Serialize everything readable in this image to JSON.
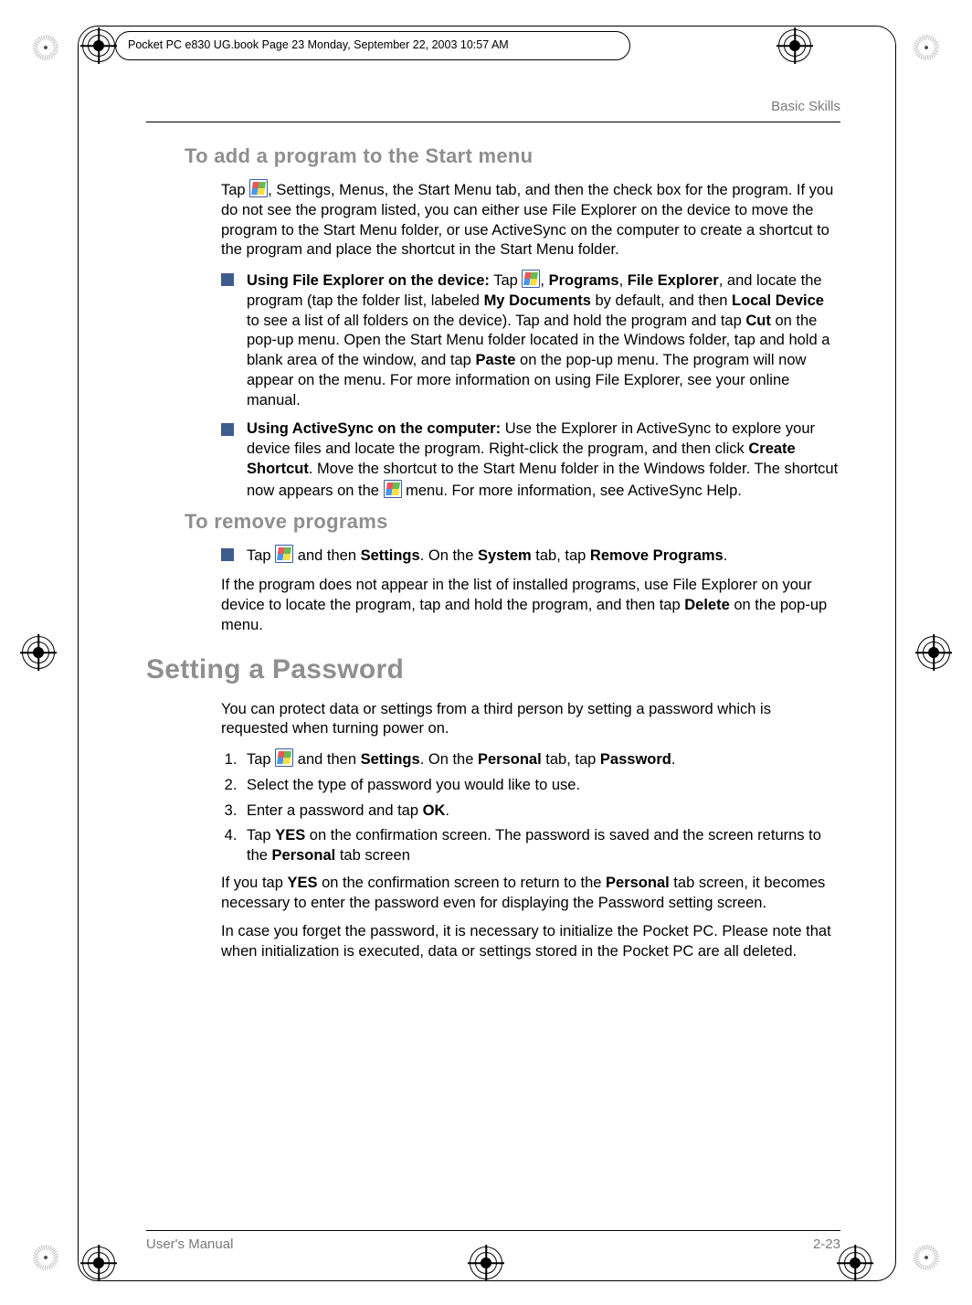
{
  "print_header": "Pocket PC e830 UG.book  Page 23  Monday, September 22, 2003  10:57 AM",
  "running_head": "Basic Skills",
  "h_add": "To add a program to the Start menu",
  "p_add_intro_a": "Tap ",
  "p_add_intro_b": ", Settings, Menus, the Start Menu tab, and then the check box for the program. If you do not see the program listed, you can either use File Explorer on the device to move the program to the Start Menu folder, or use ActiveSync on the computer to create a shortcut to the program and place the shortcut in the Start Menu folder.",
  "li1_lead": "Using File Explorer on the device:",
  "li1_a": " Tap ",
  "li1_b1": ", ",
  "li1_b2": "Programs",
  "li1_b3": ", ",
  "li1_b4": "File Explorer",
  "li1_b5": ", and locate the program (tap the folder list, labeled ",
  "li1_b6": "My Documents",
  "li1_b7": " by default, and then ",
  "li1_b8": "Local Device",
  "li1_b9": " to see a list of all folders on the device). Tap and hold the program and tap ",
  "li1_b10": "Cut",
  "li1_b11": " on the pop-up menu. Open the Start Menu folder located in the Windows folder, tap and hold a blank area of the window, and tap ",
  "li1_b12": "Paste",
  "li1_b13": " on the pop-up menu. The program will now appear on the menu. For more information on using File Explorer, see your online manual.",
  "li2_lead": "Using ActiveSync on the computer:",
  "li2_a": " Use the Explorer in ActiveSync to explore your device files and locate the program. Right-click the program, and then click ",
  "li2_b": "Create Shortcut",
  "li2_c": ". Move the shortcut to the Start Menu folder in the Windows folder. The shortcut now appears on the ",
  "li2_d": " menu. For more information, see ActiveSync Help.",
  "h_rem": "To remove programs",
  "rem_li_a": "Tap ",
  "rem_li_b": " and then ",
  "rem_li_c": "Settings",
  "rem_li_d": ". On the ",
  "rem_li_e": "System",
  "rem_li_f": " tab, tap ",
  "rem_li_g": "Remove Programs",
  "rem_li_h": ".",
  "rem_p_a": "If the program does not appear in the list of installed programs, use File Explorer on your device to locate the program, tap and hold the program, and then tap ",
  "rem_p_b": "Delete",
  "rem_p_c": " on the pop-up menu.",
  "h_pwd": "Setting a Password",
  "pwd_intro": "You can protect data or settings from a third person by setting a password which is requested when turning power on.",
  "pwd1_a": "Tap ",
  "pwd1_b": " and then ",
  "pwd1_c": "Settings",
  "pwd1_d": ". On the ",
  "pwd1_e": "Personal",
  "pwd1_f": " tab, tap ",
  "pwd1_g": "Password",
  "pwd1_h": ".",
  "pwd2": "Select the type of password you would like to use.",
  "pwd3_a": "Enter a password and tap ",
  "pwd3_b": "OK",
  "pwd3_c": ".",
  "pwd4_a": "Tap ",
  "pwd4_b": "YES",
  "pwd4_c": " on the confirmation screen. The password is saved and the screen returns to the ",
  "pwd4_d": "Personal",
  "pwd4_e": " tab screen",
  "pwd_p2_a": "If you tap ",
  "pwd_p2_b": "YES",
  "pwd_p2_c": " on the confirmation screen to return to the ",
  "pwd_p2_d": "Personal",
  "pwd_p2_e": " tab screen, it becomes necessary to enter the password even for displaying the Password setting screen.",
  "pwd_p3": "In case you forget the password, it is necessary to initialize the Pocket PC. Please note that when initialization is executed, data or settings stored in the Pocket PC are all deleted.",
  "footer_left": "User's Manual",
  "footer_right": "2-23"
}
